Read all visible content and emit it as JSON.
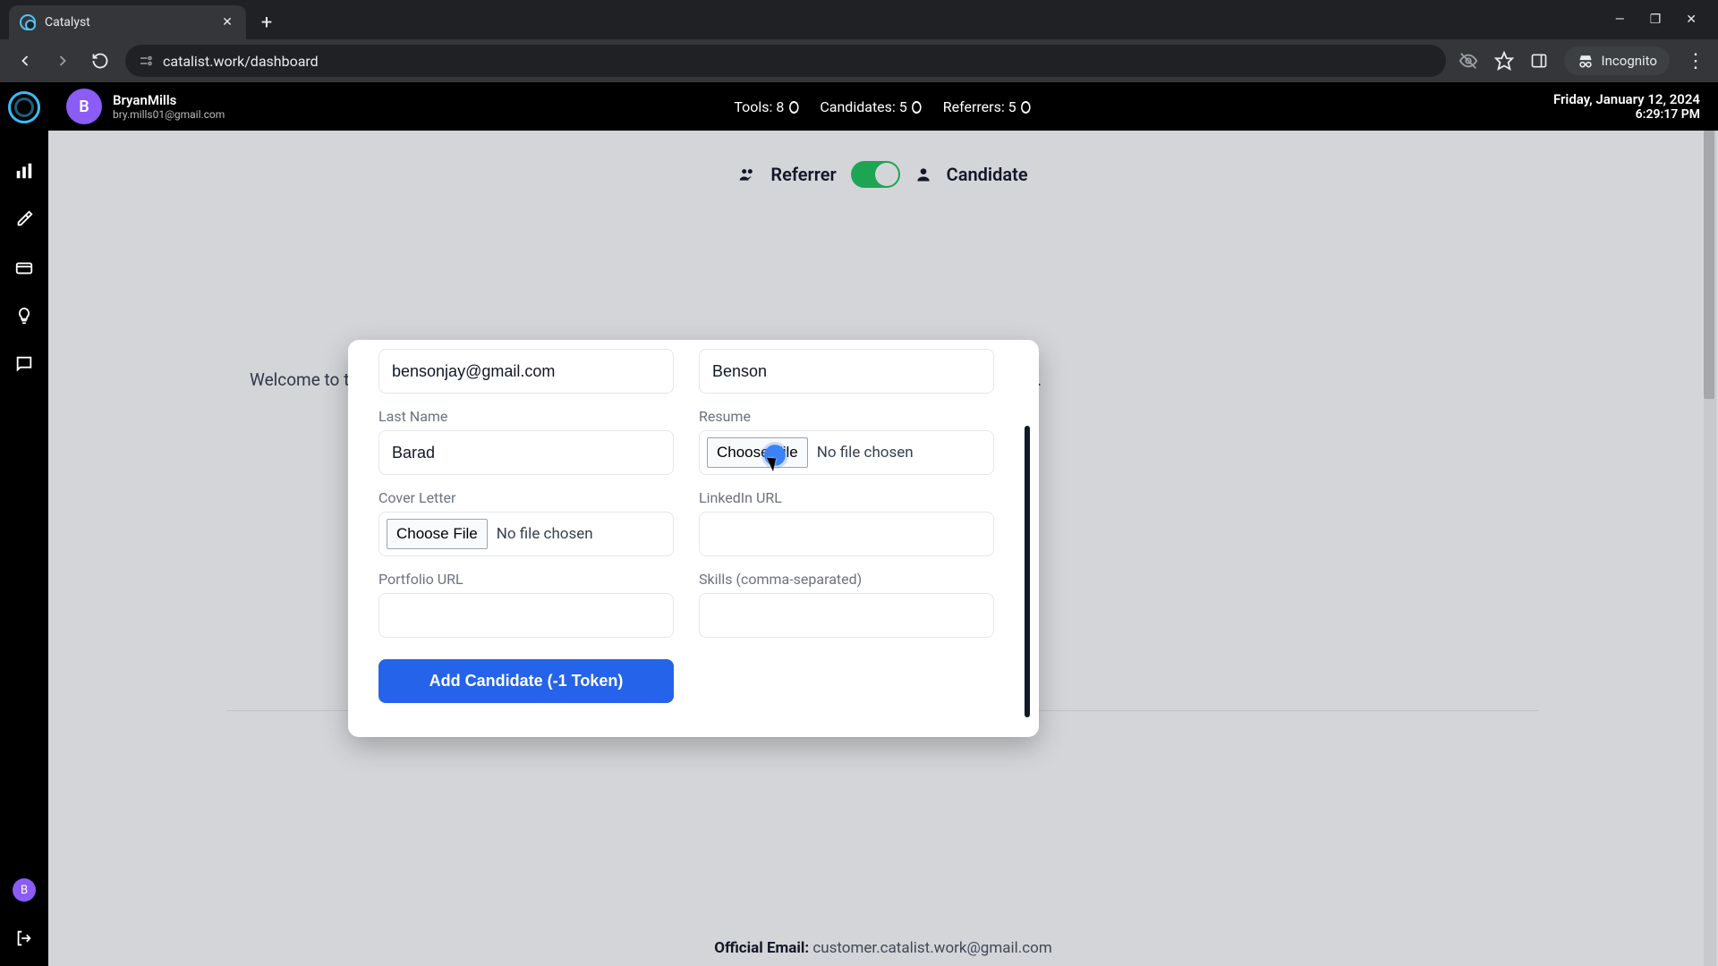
{
  "browser": {
    "tab_title": "Catalyst",
    "url": "catalist.work/dashboard",
    "incognito_label": "Incognito"
  },
  "topbar": {
    "user_initial": "B",
    "user_name": "BryanMills",
    "user_email": "bry.mills01@gmail.com",
    "stats": {
      "tools_label": "Tools: 8",
      "candidates_label": "Candidates: 5",
      "referrers_label": "Referrers: 5"
    },
    "date": "Friday, January 12, 2024",
    "time": "6:29:17 PM"
  },
  "sidebar": {
    "avatar_initial": "B"
  },
  "toggle": {
    "left_label": "Referrer",
    "right_label": "Candidate"
  },
  "welcome": {
    "text_line": "Welcome to the Catalyst Network! This is where every candidate who's ever requested a referral from you."
  },
  "modal": {
    "email_value": "bensonjay@gmail.com",
    "first_name_value": "Benson",
    "last_name_label": "Last Name",
    "last_name_value": "Barad",
    "resume_label": "Resume",
    "resume_button": "Choose File",
    "resume_status": "No file chosen",
    "cover_label": "Cover Letter",
    "cover_button": "Choose File",
    "cover_status": "No file chosen",
    "linkedin_label": "LinkedIn URL",
    "linkedin_value": "",
    "portfolio_label": "Portfolio URL",
    "portfolio_value": "",
    "skills_label": "Skills (comma-separated)",
    "skills_value": "",
    "submit_label": "Add Candidate (-1 Token)"
  },
  "footer": {
    "label": "Official Email: ",
    "email": "customer.catalist.work@gmail.com"
  }
}
